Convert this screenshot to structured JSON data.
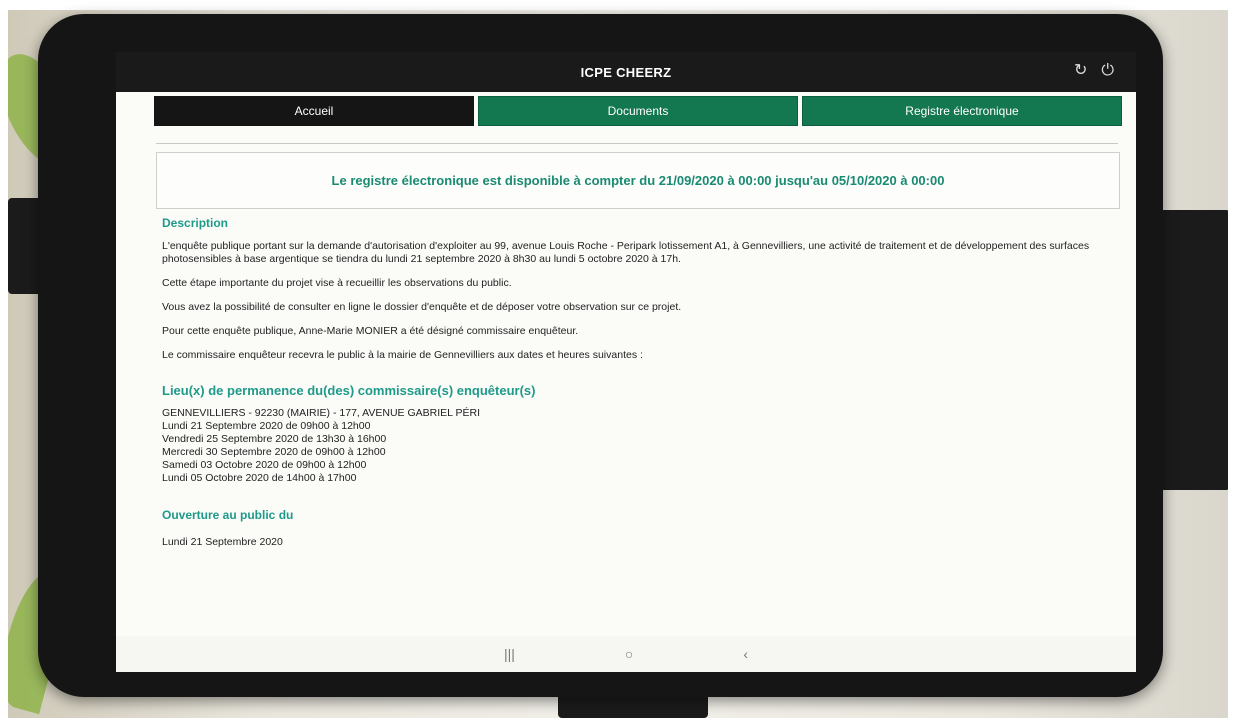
{
  "app": {
    "title": "ICPE CHEERZ",
    "refresh_icon": "refresh-icon",
    "logout_icon": "logout-icon"
  },
  "tabs": [
    {
      "label": "Accueil"
    },
    {
      "label": "Documents"
    },
    {
      "label": "Registre électronique"
    }
  ],
  "banner": {
    "text": "Le registre électronique est disponible à compter du 21/09/2020 à 00:00 jusqu'au 05/10/2020 à 00:00"
  },
  "description": {
    "title": "Description",
    "paragraphs": [
      "L'enquête publique portant sur la demande d'autorisation d'exploiter au 99, avenue Louis Roche - Peripark lotissement A1, à Gennevilliers, une activité de traitement et de développement des surfaces photosensibles à base argentique se tiendra du lundi 21 septembre 2020 à 8h30 au lundi 5 octobre 2020 à 17h.",
      "Cette étape importante du projet vise à recueillir les observations du public.",
      "Vous avez la possibilité de consulter en ligne le dossier d'enquête et de déposer votre observation sur ce projet.",
      "Pour cette enquête publique, Anne-Marie MONIER a été désigné commissaire enquêteur.",
      "Le commissaire enquêteur recevra le public à la mairie de Gennevilliers aux dates et heures suivantes :"
    ]
  },
  "permanence": {
    "title": "Lieu(x) de permanence du(des) commissaire(s) enquêteur(s)",
    "lines": [
      "GENNEVILLIERS - 92230 (MAIRIE) - 177, AVENUE GABRIEL PÉRI",
      "Lundi 21 Septembre 2020 de 09h00 à 12h00",
      "Vendredi 25 Septembre 2020 de 13h30 à 16h00",
      "Mercredi 30 Septembre 2020 de 09h00 à 12h00",
      "Samedi 03 Octobre 2020 de 09h00 à 12h00",
      "Lundi 05 Octobre 2020 de 14h00 à 17h00"
    ]
  },
  "ouverture": {
    "title": "Ouverture au public du",
    "date": "Lundi 21 Septembre 2020"
  },
  "nav": {
    "recents": "|||",
    "home": "○",
    "back": "‹"
  }
}
